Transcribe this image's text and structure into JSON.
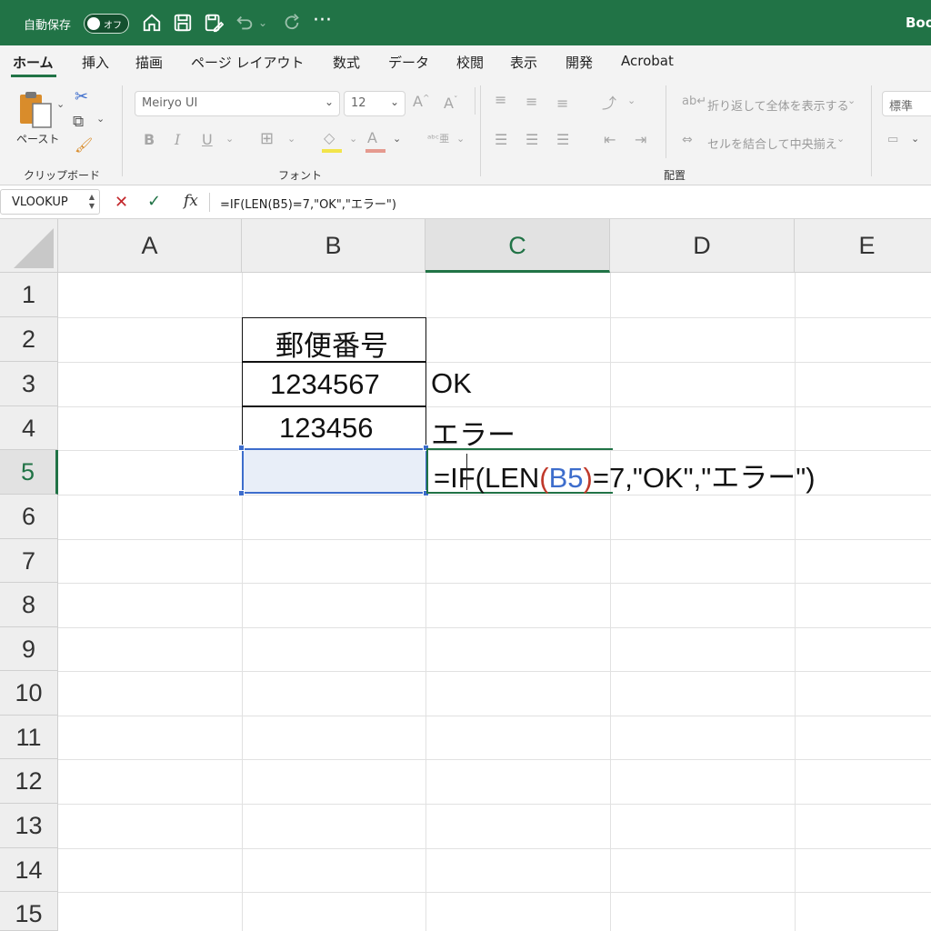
{
  "titlebar": {
    "autosave_label": "自動保存",
    "toggle_text": "オフ",
    "book_title": "Boo",
    "icons": [
      "home-icon",
      "save-icon",
      "save-as-icon",
      "undo-icon",
      "redo-icon",
      "more-icon"
    ]
  },
  "tabs": [
    {
      "label": "ホーム",
      "active": true
    },
    {
      "label": "挿入"
    },
    {
      "label": "描画"
    },
    {
      "label": "ページ レイアウト"
    },
    {
      "label": "数式"
    },
    {
      "label": "データ"
    },
    {
      "label": "校閲"
    },
    {
      "label": "表示"
    },
    {
      "label": "開発"
    },
    {
      "label": "Acrobat"
    }
  ],
  "ribbon": {
    "paste_label": "ペースト",
    "clipboard_group": "クリップボード",
    "font_group": "フォント",
    "alignment_group": "配置",
    "font_name": "Meiryo UI",
    "font_size": "12",
    "bold": "B",
    "italic": "I",
    "underline": "U",
    "wrap_text": "折り返して全体を表示する",
    "merge_center": "セルを結合して中央揃え",
    "number_format": "標準"
  },
  "formula_bar": {
    "name_box": "VLOOKUP",
    "fx": "fx",
    "formula": "=IF(LEN(B5)=7,\"OK\",\"エラー\")"
  },
  "sheet": {
    "columns": [
      "A",
      "B",
      "C",
      "D",
      "E"
    ],
    "rows": [
      "1",
      "2",
      "3",
      "4",
      "5",
      "6",
      "7",
      "8",
      "9",
      "10",
      "11",
      "12",
      "13",
      "14",
      "15"
    ],
    "b2": "郵便番号",
    "b3": "1234567",
    "b4": "123456",
    "c3": "OK",
    "c4": "エラー",
    "c5_parts": {
      "prefix": "=IF(LEN",
      "open_paren": "(",
      "ref": "B5",
      "close_paren": ")",
      "suffix": "=7,\"OK\",\"エラー\")"
    }
  },
  "colors": {
    "excel_green": "#217346",
    "reference_blue": "#3d6dcc",
    "reference_paren_red": "#c0392b"
  }
}
